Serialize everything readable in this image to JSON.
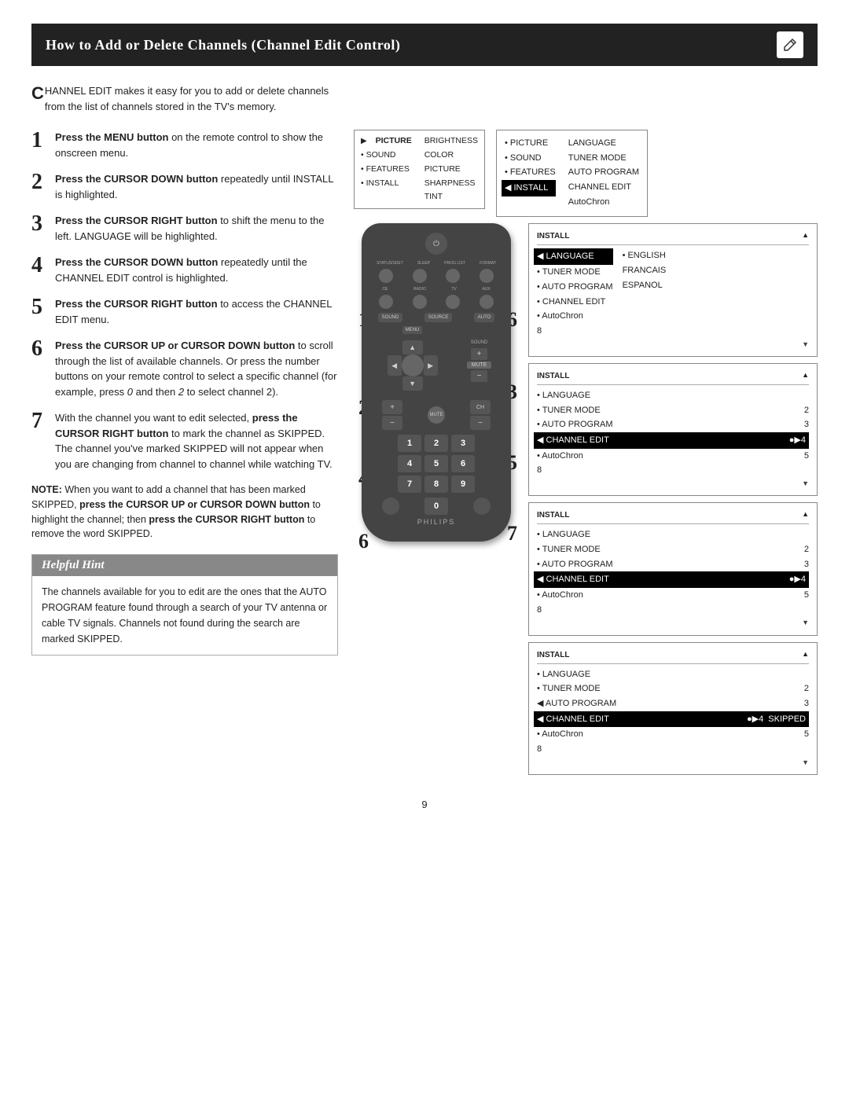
{
  "header": {
    "title": "How to Add or Delete Channels (Channel Edit Control)",
    "icon": "✎"
  },
  "intro": {
    "drop_cap": "C",
    "text": "HANNEL EDIT makes it easy for you to add or delete channels from the list of channels stored in the TV's memory."
  },
  "steps": [
    {
      "num": "1",
      "html": "<strong>Press the MENU button</strong> on the remote control to show the onscreen menu."
    },
    {
      "num": "2",
      "html": "<strong>Press the CURSOR DOWN button</strong> repeatedly until INSTALL is highlighted."
    },
    {
      "num": "3",
      "html": "<strong>Press the CURSOR RIGHT button</strong> to shift the menu to the left. LANGUAGE will be highlighted."
    },
    {
      "num": "4",
      "html": "<strong>Press the CURSOR DOWN button</strong> repeatedly until the CHANNEL EDIT control is highlighted."
    },
    {
      "num": "5",
      "html": "<strong>Press the CURSOR RIGHT button</strong> to access the CHANNEL EDIT menu."
    },
    {
      "num": "6",
      "html": "<strong>Press the CURSOR UP or CURSOR DOWN button</strong> to scroll through the list of available channels. Or press the number buttons on your remote control to select a specific channel (for example, press <em>0</em> and then <em>2</em> to select channel 2)."
    },
    {
      "num": "7",
      "html": "With the channel you want to edit selected, <strong>press the CURSOR RIGHT button</strong> to mark the channel as SKIPPED. The channel you've marked SKIPPED will not appear when you are changing from channel to channel while watching TV."
    }
  ],
  "note": {
    "label": "NOTE:",
    "text": "When you want to add a channel that has been marked SKIPPED, press the CURSOR UP or CURSOR DOWN button to highlight the channel; then press the CURSOR RIGHT button to remove the word SKIPPED."
  },
  "hint": {
    "title": "Helpful Hint",
    "text": "The channels available for you to edit are the ones that the AUTO PROGRAM feature found through a search of your TV antenna or cable TV signals. Channels not found during the search are marked SKIPPED."
  },
  "menus": {
    "small_menu": {
      "items_left": [
        "▶ PICTURE",
        "• SOUND",
        "• FEATURES",
        "• INSTALL"
      ],
      "items_right": [
        "BRIGHTNESS",
        "COLOR",
        "PICTURE",
        "SHARPNESS",
        "TINT"
      ]
    },
    "install_menu_1": {
      "title": "INSTALL",
      "items": [
        {
          "bullet": "•",
          "label": "PICTURE",
          "value": "LANGUAGE"
        },
        {
          "bullet": "•",
          "label": "SOUND",
          "value": "TUNER MODE"
        },
        {
          "bullet": "•",
          "label": "FEATURES",
          "value": "AUTO PROGRAM"
        },
        {
          "bullet": "◀",
          "label": "INSTALL",
          "value": "CHANNEL EDIT",
          "highlighted": false
        },
        {
          "bullet": "",
          "label": "",
          "value": "AutoChron"
        }
      ]
    },
    "install_menu_2": {
      "title": "INSTALL",
      "items": [
        {
          "bullet": "•",
          "label": "LANGUAGE",
          "highlighted": true
        },
        {
          "bullet": "•",
          "label": "TUNER MODE"
        },
        {
          "bullet": "•",
          "label": "AUTO PROGRAM"
        },
        {
          "bullet": "•",
          "label": "CHANNEL EDIT"
        },
        {
          "bullet": "•",
          "label": "AutoChron"
        },
        {
          "bullet": "",
          "label": "8"
        }
      ],
      "right_col": [
        "• ENGLISH",
        "FRANCAIS",
        "ESPANOL"
      ]
    },
    "install_menu_3": {
      "title": "INSTALL",
      "items": [
        {
          "bullet": "•",
          "label": "LANGUAGE"
        },
        {
          "bullet": "•",
          "label": "TUNER MODE",
          "value": "2"
        },
        {
          "bullet": "•",
          "label": "AUTO PROGRAM",
          "value": "3"
        },
        {
          "bullet": "◀",
          "label": "CHANNEL EDIT",
          "value": "●▶4",
          "highlighted": true
        },
        {
          "bullet": "•",
          "label": "AutoChron",
          "value": "5"
        },
        {
          "bullet": "",
          "label": "8"
        }
      ]
    },
    "install_menu_4": {
      "title": "INSTALL",
      "items": [
        {
          "bullet": "•",
          "label": "LANGUAGE"
        },
        {
          "bullet": "•",
          "label": "TUNER MODE",
          "value": "2"
        },
        {
          "bullet": "•",
          "label": "AUTO PROGRAM",
          "value": "3"
        },
        {
          "bullet": "◀",
          "label": "CHANNEL EDIT",
          "value": "●▶4",
          "highlighted": true
        },
        {
          "bullet": "•",
          "label": "AutoChron",
          "value": "5"
        },
        {
          "bullet": "",
          "label": "8"
        }
      ]
    },
    "install_menu_5": {
      "title": "INSTALL",
      "items": [
        {
          "bullet": "•",
          "label": "LANGUAGE"
        },
        {
          "bullet": "•",
          "label": "TUNER MODE",
          "value": "2"
        },
        {
          "bullet": "•",
          "label": "AUTO PROGRAM",
          "value": "3"
        },
        {
          "bullet": "◀",
          "label": "CHANNEL EDIT",
          "value": "●▶4  SKIPPED",
          "highlighted": true
        },
        {
          "bullet": "•",
          "label": "AutoChron",
          "value": "5"
        },
        {
          "bullet": "",
          "label": "8"
        }
      ]
    }
  },
  "page_number": "9",
  "step_labels": {
    "step1_overlay": "1",
    "step2_overlay": "2",
    "step3_overlay": "3",
    "step4_overlay": "4",
    "step5_overlay": "5",
    "step6_overlay": "6",
    "step7_overlay": "7"
  }
}
